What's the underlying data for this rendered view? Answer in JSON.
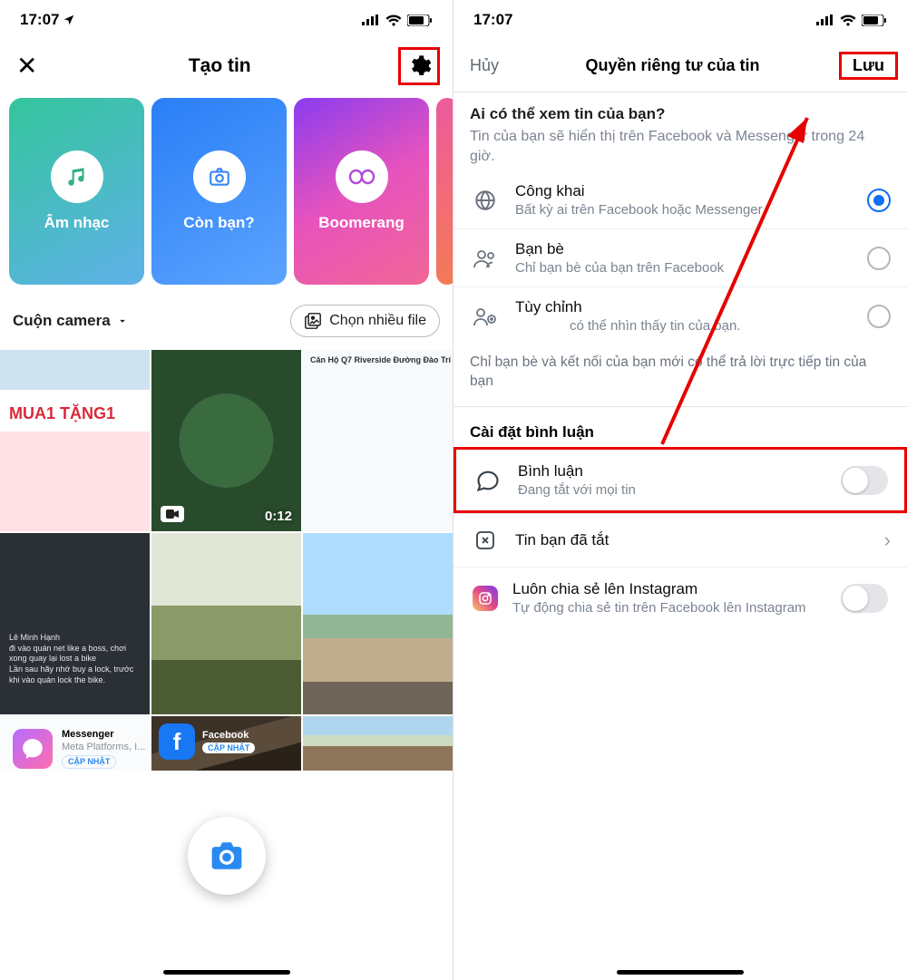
{
  "status": {
    "time": "17:07"
  },
  "left": {
    "title": "Tạo tin",
    "tiles": {
      "music": "Âm nhạc",
      "selfie": "Còn bạn?",
      "boomerang": "Boomerang"
    },
    "camera_roll": "Cuộn camera",
    "multi_select": "Chọn nhiều file",
    "video_duration": "0:12",
    "apps": {
      "messenger_name": "Messenger",
      "messenger_sub": "Meta Platforms, I...",
      "messenger_btn": "CẬP NHẬT",
      "facebook_name": "Facebook",
      "facebook_btn": "CẬP NHẬT"
    }
  },
  "right": {
    "cancel": "Hủy",
    "title": "Quyền riêng tư của tin",
    "save": "Lưu",
    "question": "Ai có thể xem tin của bạn?",
    "question_sub": "Tin của bạn sẽ hiển thị trên Facebook và Messenger trong 24 giờ.",
    "opts": {
      "public_t": "Công khai",
      "public_s": "Bất kỳ ai trên Facebook hoặc Messenger",
      "friends_t": "Bạn bè",
      "friends_s": "Chỉ bạn bè của bạn trên Facebook",
      "custom_t": "Tùy chỉnh",
      "custom_s": "có thể nhìn thấy tin của bạn."
    },
    "reply_note": "Chỉ bạn bè và kết nối của bạn mới có thể trả lời trực tiếp tin của bạn",
    "comment_section": "Cài đặt bình luận",
    "comment_t": "Bình luận",
    "comment_s": "Đang tắt với mọi tin",
    "muted": "Tin bạn đã tắt",
    "ig_t": "Luôn chia sẻ lên Instagram",
    "ig_s": "Tự động chia sẻ tin trên Facebook lên Instagram"
  }
}
